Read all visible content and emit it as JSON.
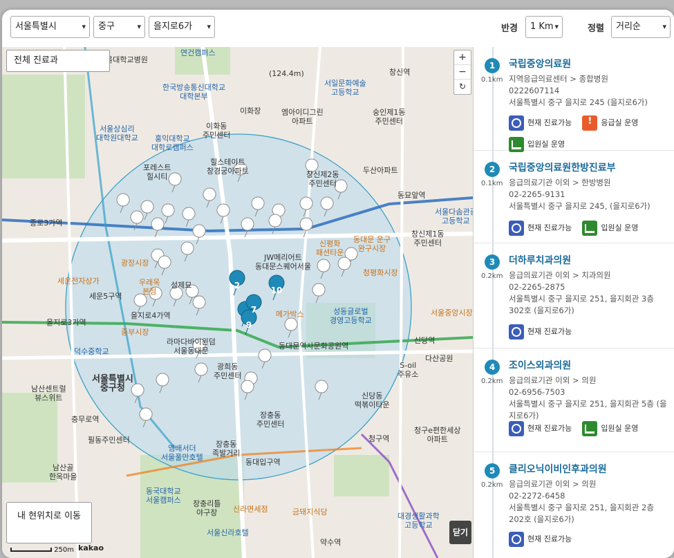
{
  "filters": {
    "sido": "서울특별시",
    "sigungu": "중구",
    "dong": "을지로6가",
    "radius_label": "반경",
    "radius_value": "1 Km",
    "sort_label": "정렬",
    "sort_value": "거리순"
  },
  "map": {
    "department_button": "전체 진료과",
    "zoom_in": "+",
    "zoom_out": "−",
    "reset": "↻",
    "my_location_button": "내 현위치로 이동",
    "close_button": "닫기",
    "scale": "250m",
    "attribution": "kakao",
    "labels": [
      {
        "text": "연건캠퍼스",
        "style": "blue"
      },
      {
        "text": "한국방송통신대학교\n대학본부",
        "style": "blue"
      },
      {
        "text": "서울대학교병원",
        "style": ""
      },
      {
        "text": "(124.4m)",
        "style": ""
      },
      {
        "text": "서일문화예술\n고등학교",
        "style": "blue"
      },
      {
        "text": "창신역",
        "style": ""
      },
      {
        "text": "숭인제1동\n주민센터",
        "style": ""
      },
      {
        "text": "이화장",
        "style": ""
      },
      {
        "text": "엠아이디그린\n아파트",
        "style": ""
      },
      {
        "text": "이화동\n주민센터",
        "style": ""
      },
      {
        "text": "서울상심리\n대학원대학교",
        "style": "blue"
      },
      {
        "text": "홍익대학교\n대학로캠퍼스",
        "style": "blue"
      },
      {
        "text": "힐스테이트\n창경궁아파트",
        "style": ""
      },
      {
        "text": "포레스트\n힐시티",
        "style": ""
      },
      {
        "text": "창신제2동\n주민센터",
        "style": ""
      },
      {
        "text": "두산아파트",
        "style": ""
      },
      {
        "text": "동묘앞역",
        "style": ""
      },
      {
        "text": "서울다솜관광\n고등학교",
        "style": "blue"
      },
      {
        "text": "종로3가역",
        "style": ""
      },
      {
        "text": "창신제1동\n주민센터",
        "style": ""
      },
      {
        "text": "신평화\n패션타운",
        "style": "orange"
      },
      {
        "text": "동대문 운구\n완구시장",
        "style": "orange"
      },
      {
        "text": "광장시장",
        "style": "orange"
      },
      {
        "text": "JW메리어트\n동대문스퀘어서울",
        "style": ""
      },
      {
        "text": "청평화시장",
        "style": "orange"
      },
      {
        "text": "세운전자상가",
        "style": "orange"
      },
      {
        "text": "우래옥\n본점",
        "style": "orange"
      },
      {
        "text": "성제묘",
        "style": ""
      },
      {
        "text": "을지로4가역",
        "style": ""
      },
      {
        "text": "세운5구역",
        "style": ""
      },
      {
        "text": "메가박스",
        "style": "orange"
      },
      {
        "text": "성동글로벌\n경영고등학교",
        "style": "blue"
      },
      {
        "text": "서울중앙시장",
        "style": "orange"
      },
      {
        "text": "을지로3가역",
        "style": ""
      },
      {
        "text": "중부시장",
        "style": "orange"
      },
      {
        "text": "라마다바이윈덤\n서울동대문",
        "style": ""
      },
      {
        "text": "동대문역사문화공원역",
        "style": ""
      },
      {
        "text": "신당역",
        "style": ""
      },
      {
        "text": "덕수중학교",
        "style": "blue"
      },
      {
        "text": "광희동\n주민센터",
        "style": ""
      },
      {
        "text": "S-oil\n주유소",
        "style": ""
      },
      {
        "text": "다산공원",
        "style": ""
      },
      {
        "text": "서울특별시\n중구청",
        "style": "big"
      },
      {
        "text": "남산센트럴\n뷰스위트",
        "style": ""
      },
      {
        "text": "신당동\n떡볶이타운",
        "style": ""
      },
      {
        "text": "충무로역",
        "style": ""
      },
      {
        "text": "장충동\n주민센터",
        "style": ""
      },
      {
        "text": "청구역",
        "style": ""
      },
      {
        "text": "청구e편한세상\n아파트",
        "style": ""
      },
      {
        "text": "필동주민센터",
        "style": ""
      },
      {
        "text": "엠배서더\n서울풀만호텔",
        "style": "blue"
      },
      {
        "text": "장충동\n족발거리",
        "style": ""
      },
      {
        "text": "동대입구역",
        "style": ""
      },
      {
        "text": "남산골\n한옥마을",
        "style": ""
      },
      {
        "text": "동국대학교\n서울캠퍼스",
        "style": "blue"
      },
      {
        "text": "장충리틀\n야구장",
        "style": ""
      },
      {
        "text": "신라면세점",
        "style": "orange"
      },
      {
        "text": "금돼지식당",
        "style": "orange"
      },
      {
        "text": "대경생활과학\n고등학교",
        "style": "blue"
      },
      {
        "text": "약수역",
        "style": ""
      },
      {
        "text": "서울신라호텔",
        "style": "blue"
      }
    ],
    "cluster_numbers": [
      "2",
      "10",
      "7",
      "9"
    ]
  },
  "hospitals": [
    {
      "rank": "1",
      "distance": "0.1km",
      "name": "국립중앙의료원",
      "type": "지역응급의료센터 > 종합병원",
      "phone": "0222607114",
      "address": "서울특별시 중구 을지로 245 (을지로6가)",
      "badges": [
        {
          "icon": "clock-icon",
          "label": "현재 진료가능"
        },
        {
          "icon": "emergency-icon",
          "label": "응급실 운영"
        },
        {
          "icon": "bed-icon",
          "label": "입원실 운영"
        }
      ]
    },
    {
      "rank": "2",
      "distance": "0.1km",
      "name": "국립중앙의료원한방진료부",
      "type": "응급의료기관 이외 > 한방병원",
      "phone": "02-2265-9131",
      "address": "서울특별시 중구 을지로 245, (을지로6가)",
      "badges": [
        {
          "icon": "clock-icon",
          "label": "현재 진료가능"
        },
        {
          "icon": "bed-icon",
          "label": "입원실 운영"
        }
      ]
    },
    {
      "rank": "3",
      "distance": "0.2km",
      "name": "더하루치과의원",
      "type": "응급의료기관 이외 > 치과의원",
      "phone": "02-2265-2875",
      "address": "서울특별시 중구 을지로 251, 을지회관 3층 302호 (을지로6가)",
      "badges": [
        {
          "icon": "clock-icon",
          "label": "현재 진료가능"
        }
      ]
    },
    {
      "rank": "4",
      "distance": "0.2km",
      "name": "조이스외과의원",
      "type": "응급의료기관 이외 > 의원",
      "phone": "02-6956-7503",
      "address": "서울특별시 중구 을지로 251, 을지회관 5층 (을지로6가)",
      "badges": [
        {
          "icon": "clock-icon",
          "label": "현재 진료가능"
        },
        {
          "icon": "bed-icon",
          "label": "입원실 운영"
        }
      ]
    },
    {
      "rank": "5",
      "distance": "0.2km",
      "name": "클리오닉이비인후과의원",
      "type": "응급의료기관 이외 > 의원",
      "phone": "02-2272-6458",
      "address": "서울특별시 중구 을지로 251, 을지회관 2층 202호 (을지로6가)",
      "badges": [
        {
          "icon": "clock-icon",
          "label": "현재 진료가능"
        }
      ]
    }
  ]
}
